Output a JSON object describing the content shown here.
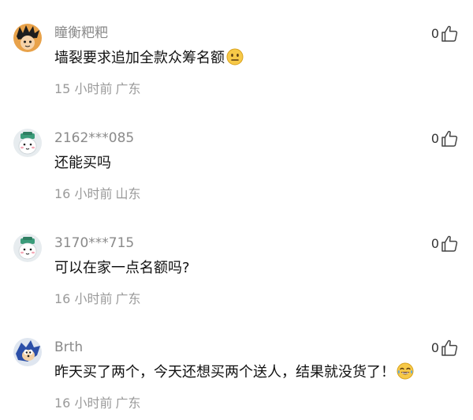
{
  "comments": [
    {
      "username": "瞳衡粑粑",
      "avatar": "cartoon-boy-avatar",
      "text": "墙裂要求追加全款众筹名额",
      "emoji": "neutral-face-emoji",
      "time": "15 小时前",
      "location": "广东",
      "likes": "0"
    },
    {
      "username": "2162***085",
      "avatar": "default-mascot-avatar",
      "text": "还能买吗",
      "emoji": "",
      "time": "16 小时前",
      "location": "山东",
      "likes": "0"
    },
    {
      "username": "3170***715",
      "avatar": "default-mascot-avatar",
      "text": "可以在家一点名额吗?",
      "emoji": "",
      "time": "16 小时前",
      "location": "广东",
      "likes": "0"
    },
    {
      "username": "Brth",
      "avatar": "blue-hedgehog-avatar",
      "text": "昨天买了两个，今天还想买两个送人，结果就没货了！",
      "emoji": "tears-of-joy-emoji",
      "time": "16 小时前",
      "location": "广东",
      "likes": "0"
    }
  ]
}
